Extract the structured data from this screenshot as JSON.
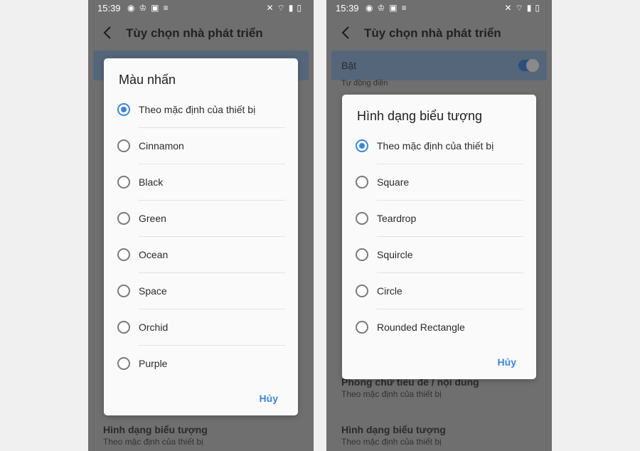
{
  "status_bar": {
    "time": "15:39"
  },
  "appbar": {
    "title": "Tùy chọn nhà phát triển"
  },
  "left_screen": {
    "background_items": [
      {
        "title": "Hình dạng biểu tượng",
        "subtitle": "Theo mặc định của thiết bị"
      }
    ],
    "dialog": {
      "title": "Màu nhấn",
      "options": [
        {
          "label": "Theo mặc định của thiết bị",
          "checked": true
        },
        {
          "label": "Cinnamon",
          "checked": false
        },
        {
          "label": "Black",
          "checked": false
        },
        {
          "label": "Green",
          "checked": false
        },
        {
          "label": "Ocean",
          "checked": false
        },
        {
          "label": "Space",
          "checked": false
        },
        {
          "label": "Orchid",
          "checked": false
        },
        {
          "label": "Purple",
          "checked": false
        }
      ],
      "cancel_label": "Hủy"
    }
  },
  "right_screen": {
    "highlight": {
      "label": "Bật",
      "subtitle": "Tự động điền",
      "toggle_on": true
    },
    "background_items": [
      {
        "title": "Phông chữ tiêu đề / nội dung",
        "subtitle": "Theo mặc định của thiết bị"
      },
      {
        "title": "Hình dạng biểu tượng",
        "subtitle": "Theo mặc định của thiết bị"
      }
    ],
    "dialog": {
      "title": "Hình dạng biểu tượng",
      "options": [
        {
          "label": "Theo mặc định của thiết bị",
          "checked": true
        },
        {
          "label": "Square",
          "checked": false
        },
        {
          "label": "Teardrop",
          "checked": false
        },
        {
          "label": "Squircle",
          "checked": false
        },
        {
          "label": "Circle",
          "checked": false
        },
        {
          "label": "Rounded Rectangle",
          "checked": false
        }
      ],
      "cancel_label": "Hủy"
    }
  },
  "colors": {
    "accent": "#3d86d6",
    "scrim": "#6f6f6f",
    "dialog_bg": "#fafafa"
  },
  "icons": {
    "status_left": [
      "messenger-icon",
      "app-notification-icon",
      "image-icon",
      "menu-icon"
    ],
    "status_right": [
      "mute-icon",
      "wifi-icon",
      "signal-icon",
      "battery-icon"
    ],
    "back": "back-arrow-icon"
  }
}
